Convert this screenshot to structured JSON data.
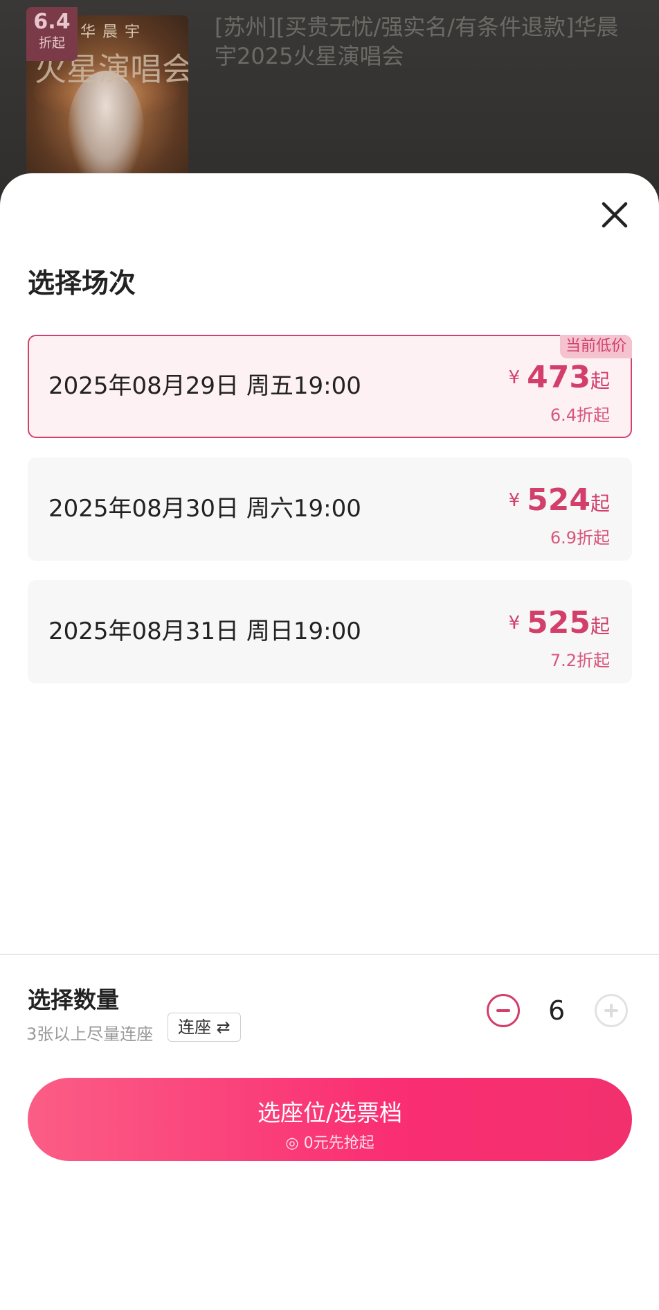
{
  "header": {
    "poster": {
      "discount_value": "6.4",
      "discount_unit": "折起",
      "artist": "华晨宇",
      "title_art": "火星演唱会"
    },
    "title": "[苏州][买贵无忧/强实名/有条件退款]华晨宇2025火星演唱会"
  },
  "sheet": {
    "title": "选择场次",
    "sessions": [
      {
        "date": "2025年08月29日 周五19:00",
        "currency": "¥",
        "price": "473",
        "price_suffix": "起",
        "discount": "6.4折起",
        "tag": "当前低价",
        "selected": true
      },
      {
        "date": "2025年08月30日 周六19:00",
        "currency": "¥",
        "price": "524",
        "price_suffix": "起",
        "discount": "6.9折起",
        "selected": false
      },
      {
        "date": "2025年08月31日 周日19:00",
        "currency": "¥",
        "price": "525",
        "price_suffix": "起",
        "discount": "7.2折起",
        "selected": false
      }
    ]
  },
  "quantity": {
    "title": "选择数量",
    "hint": "3张以上尽量连座",
    "seat_toggle_label": "连座 ⇄",
    "value": "6"
  },
  "cta": {
    "label": "选座位/选票档",
    "sub": "◎ 0元先抢起"
  },
  "colors": {
    "accent": "#d23f6b",
    "selected_bg": "#fdf1f3",
    "cta_start": "#fb5d86",
    "cta_end": "#f2306e"
  }
}
